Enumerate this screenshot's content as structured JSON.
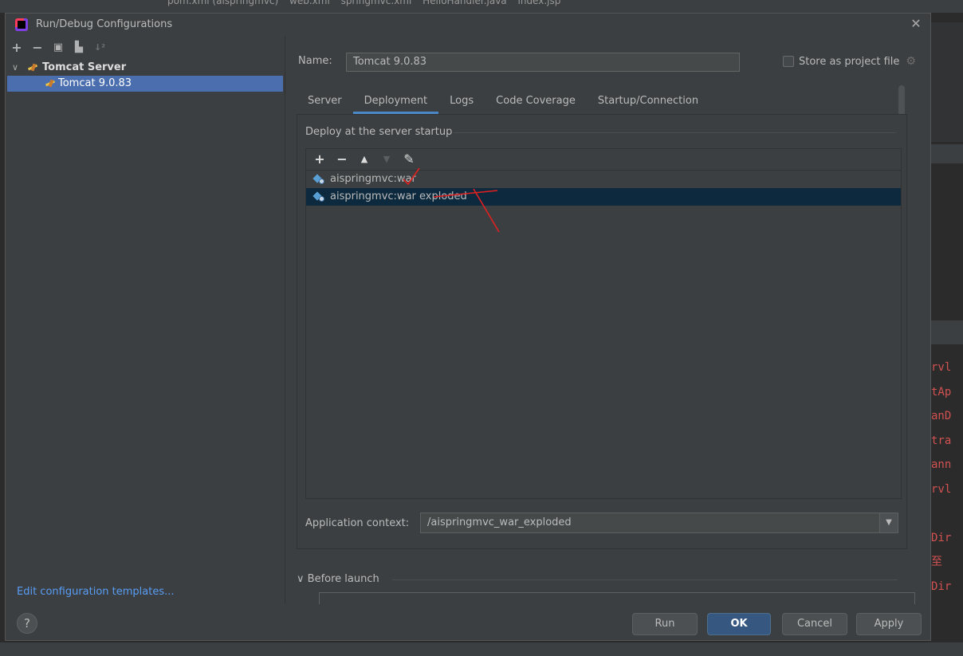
{
  "ide_background": {
    "tabs": [
      "pom.xml (aispringmvc)",
      "web.xml",
      "springmvc.xml",
      "HelloHandler.java",
      "index.jsp"
    ],
    "code_fragments": [
      "rvl",
      "tAp",
      "anD",
      "tra",
      "ann",
      "rvl",
      "",
      "Dir",
      "至",
      "Dir"
    ]
  },
  "dialog": {
    "title": "Run/Debug Configurations",
    "close_icon": "close-icon"
  },
  "left_panel": {
    "toolbar": [
      "add",
      "remove",
      "copy",
      "move-to-folder",
      "sort"
    ],
    "tree": {
      "group_label": "Tomcat Server",
      "child_label": "Tomcat 9.0.83"
    },
    "edit_templates_link": "Edit configuration templates..."
  },
  "right_panel": {
    "name_label": "Name:",
    "name_value": "Tomcat 9.0.83",
    "store_as_project_file": "Store as project file",
    "store_checked": false,
    "tabs": [
      "Server",
      "Deployment",
      "Logs",
      "Code Coverage",
      "Startup/Connection"
    ],
    "active_tab": "Deployment",
    "deploy_group_title": "Deploy at the server startup",
    "artifacts": [
      {
        "label": "aispringmvc:war",
        "selected": false
      },
      {
        "label": "aispringmvc:war exploded",
        "selected": true
      }
    ],
    "application_context_label": "Application context:",
    "application_context_value": "/aispringmvc_war_exploded",
    "before_launch_label": "Before launch"
  },
  "buttons": {
    "help": "?",
    "run": "Run",
    "ok": "OK",
    "cancel": "Cancel",
    "apply": "Apply"
  },
  "colors": {
    "selection_tree": "#4b6eaf",
    "selection_list": "#0d293e",
    "link": "#589df6",
    "ok_button": "#365880",
    "annotation_red": "#e02020"
  }
}
